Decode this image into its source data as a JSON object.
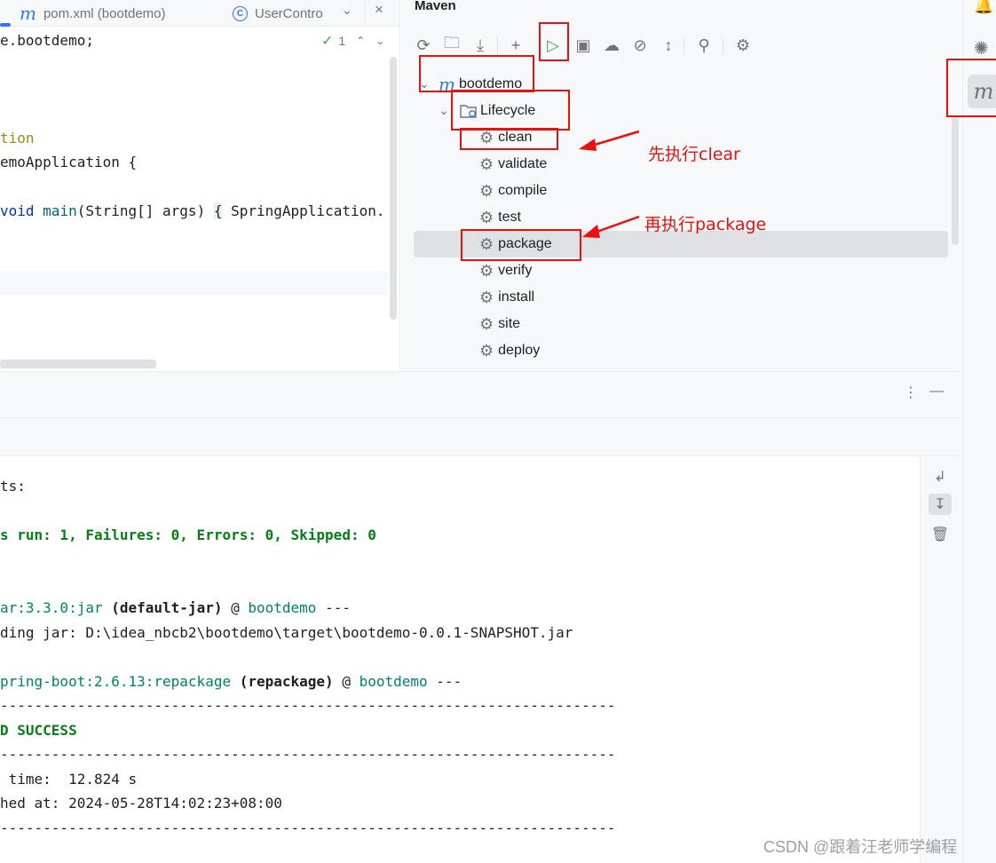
{
  "editor": {
    "tabs": [
      {
        "label": "pom.xml (bootdemo)",
        "icon": "maven-icon"
      },
      {
        "label": "UserContro",
        "icon": "class-icon"
      }
    ],
    "inspection_count": "1",
    "code": {
      "line_package": "e.bootdemo;",
      "line_annotation": "tion",
      "line_class": "emoApplication {",
      "line_main_kw": "void ",
      "line_main_fn": "main",
      "line_main_args": "(String[] args) ",
      "line_main_brace": "{",
      "line_main_body": " SpringApplication."
    }
  },
  "maven": {
    "title": "Maven",
    "project": "bootdemo",
    "lifecycle": "Lifecycle",
    "goals": [
      "clean",
      "validate",
      "compile",
      "test",
      "package",
      "verify",
      "install",
      "site",
      "deploy"
    ],
    "selected_goal": "package"
  },
  "console": {
    "lines": {
      "l1": "ts:",
      "l2": "s run: 1, Failures: 0, Errors: 0, Skipped: 0",
      "l3_a": "ar:3.3.0:jar ",
      "l3_b": "(default-jar)",
      "l3_c": " @ ",
      "l3_d": "bootdemo",
      "l3_e": " ---",
      "l4": "ding jar: D:\\idea_nbcb2\\bootdemo\\target\\bootdemo-0.0.1-SNAPSHOT.jar",
      "l5_a": "pring-boot:2.6.13:repackage ",
      "l5_b": "(repackage)",
      "l5_c": " @ ",
      "l5_d": "bootdemo",
      "l5_e": " ---",
      "sep1": "------------------------------------------------------------------------",
      "success": "D SUCCESS",
      "sep2": "------------------------------------------------------------------------",
      "time": " time:  12.824 s",
      "finished": "hed at: 2024-05-28T14:02:23+08:00",
      "sep3": "------------------------------------------------------------------------"
    }
  },
  "annotations": {
    "first": "先执行clear",
    "second": "再执行package"
  },
  "watermark": "CSDN @跟着汪老师学编程",
  "colors": {
    "accent": "#3574f0",
    "annotation_red": "#e8110f",
    "success_green": "#067d17",
    "link_teal": "#00806d"
  }
}
